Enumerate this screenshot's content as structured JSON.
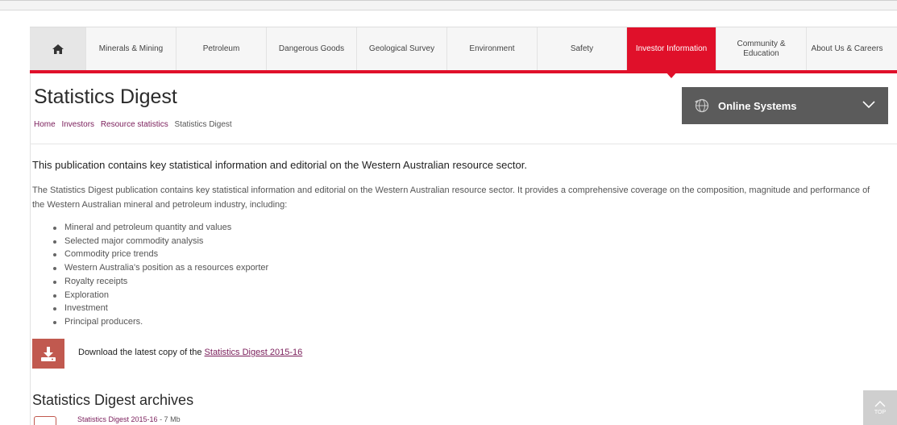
{
  "nav": {
    "home_icon": "home-icon",
    "items": [
      {
        "label": "Minerals & Mining"
      },
      {
        "label": "Petroleum"
      },
      {
        "label": "Dangerous Goods"
      },
      {
        "label": "Geological Survey"
      },
      {
        "label": "Environment"
      },
      {
        "label": "Safety"
      },
      {
        "label": "Investor Information",
        "active": true
      },
      {
        "label": "Community & Education"
      },
      {
        "label": "About Us & Careers"
      }
    ],
    "active_color": "#e0102a"
  },
  "page": {
    "title": "Statistics Digest",
    "breadcrumb": [
      "Home",
      "Investors",
      "Resource statistics",
      "Statistics Digest"
    ]
  },
  "online_systems": {
    "label": "Online Systems",
    "icon": "globe-icon",
    "toggle_icon": "chevron-down-icon"
  },
  "content": {
    "lead": "This publication contains key statistical information and editorial on the Western Australian resource sector.",
    "intro": "The Statistics Digest publication contains key statistical information and editorial on the Western Australian resource sector. It provides a comprehensive coverage on the composition, magnitude and performance of the Western Australian mineral and petroleum industry, including:",
    "bullets": [
      "Mineral and petroleum quantity and values",
      "Selected major commodity analysis",
      "Commodity price trends",
      "Western Australia's position as a resources exporter",
      "Royalty receipts",
      "Exploration",
      "Investment",
      "Principal producers."
    ],
    "download": {
      "prefix": "Download the latest copy of the",
      "link": "Statistics Digest 2015-16",
      "icon": "download-icon"
    }
  },
  "archives": {
    "heading": "Statistics Digest archives",
    "items": [
      {
        "link": "Statistics Digest 2015-16",
        "size": " - 7 Mb",
        "icon": "pdf-icon"
      }
    ]
  },
  "back_to_top": {
    "label": "TOP",
    "icon": "chevron-up-icon"
  }
}
